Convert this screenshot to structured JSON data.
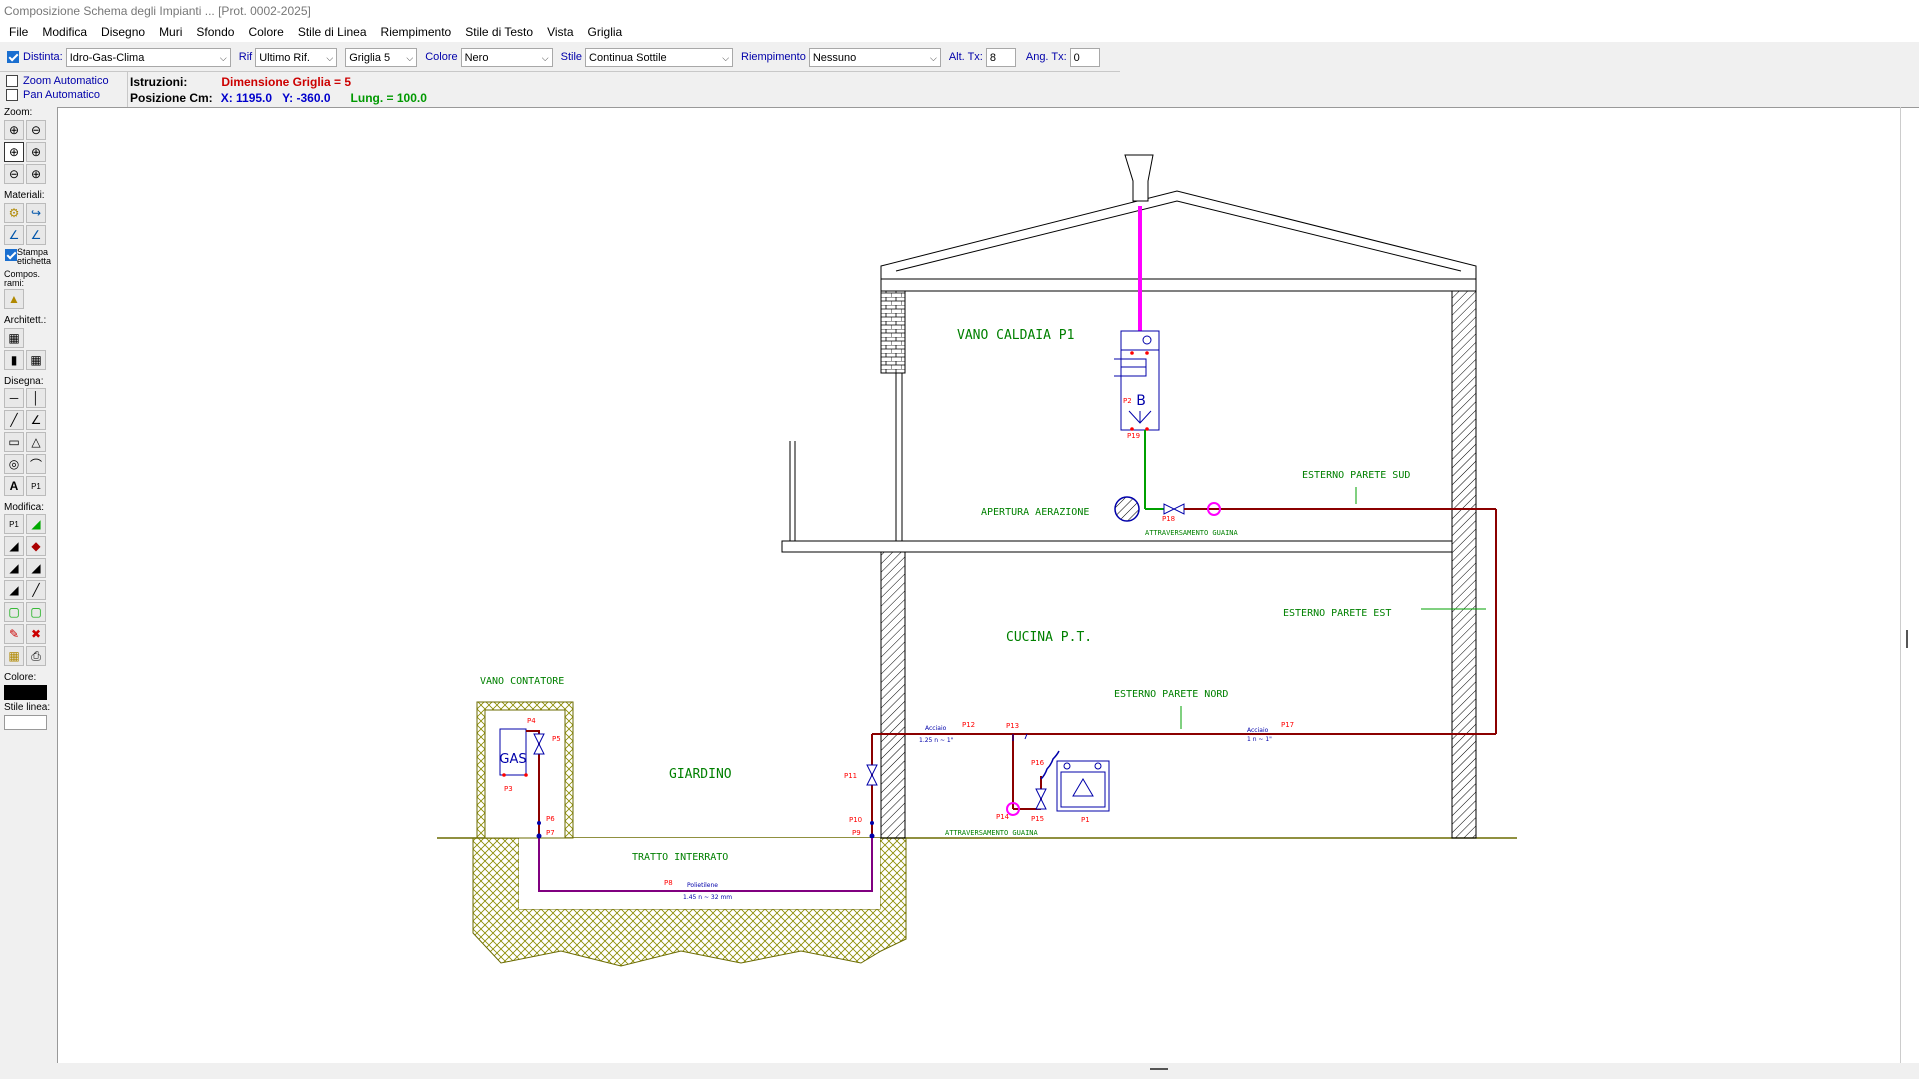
{
  "window": {
    "title": "Composizione Schema degli Impianti ...   [Prot.  0002-2025]"
  },
  "menu": [
    "File",
    "Modifica",
    "Disegno",
    "Muri",
    "Sfondo",
    "Colore",
    "Stile di Linea",
    "Riempimento",
    "Stile di Testo",
    "Vista",
    "Griglia"
  ],
  "toolbar": {
    "distinta_label": "Distinta:",
    "distinta_value": "Idro-Gas-Clima",
    "rif_label": "Rif",
    "rif_value": "Ultimo Rif.",
    "griglia_value": "Griglia  5",
    "colore_label": "Colore",
    "colore_value": "Nero",
    "stile_label": "Stile",
    "stile_value": "Continua Sottile",
    "riempimento_label": "Riempimento",
    "riempimento_value": "Nessuno",
    "alt_label": "Alt. Tx:",
    "alt_value": "8",
    "ang_label": "Ang. Tx:",
    "ang_value": "0"
  },
  "options": {
    "zoom_auto": "Zoom Automatico",
    "pan_auto": "Pan Automatico"
  },
  "instructions": {
    "istruzioni_label": "Istruzioni:",
    "istruzioni_value": "Dimensione Griglia = 5",
    "posizione_label": "Posizione  Cm:",
    "x_value": "X: 1195.0",
    "y_value": "Y:  -360.0",
    "lung_value": "Lung. =  100.0"
  },
  "sidebar": {
    "zoom": "Zoom:",
    "materiali": "Materiali:",
    "stampa": "Stampa",
    "etichetta": "etichetta",
    "compos": "Compos.",
    "rami": "rami:",
    "architett": "Architett.:",
    "disegna": "Disegna:",
    "modifica": "Modifica:",
    "colore": "Colore:",
    "stile_linea": "Stile linea:"
  },
  "drawing": {
    "labels": {
      "vano_caldaia": "VANO CALDAIA P1",
      "apertura": "APERTURA AERAZIONE",
      "esterno_sud": "ESTERNO PARETE SUD",
      "esterno_est": "ESTERNO PARETE EST",
      "esterno_nord": "ESTERNO PARETE NORD",
      "cucina": "CUCINA P.T.",
      "vano_contatore": "VANO CONTATORE",
      "giardino": "GIARDINO",
      "tratto": "TRATTO INTERRATO",
      "attraversamento1": "ATTRAVERSAMENTO GUAINA",
      "attraversamento2": "ATTRAVERSAMENTO GUAINA",
      "gas": "GAS",
      "boiler": "B"
    },
    "points": {
      "P1": "P1",
      "P2": "P2",
      "P3": "P3",
      "P4": "P4",
      "P5": "P5",
      "P6": "P6",
      "P7": "P7",
      "P8": "P8",
      "P9": "P9",
      "P10": "P10",
      "P11": "P11",
      "P12": "P12",
      "P13": "P13",
      "P14": "P14",
      "P15": "P15",
      "P16": "P16",
      "P17": "P17",
      "P18": "P18",
      "P19": "P19"
    },
    "pipe_notes": {
      "n1": "Acciaio",
      "n2": "1.25 n ~ 1\"",
      "n3": "Polietilene",
      "n4": "1.45 n ~ 32 mm",
      "n5": "Acciaio",
      "n6": "1 n ~ 1\""
    },
    "colors": {
      "gas_pipe": "#8b0000",
      "flue": "#ff00ff",
      "green_pipe": "#00a000",
      "text_green": "#008000",
      "point_red": "#ff0000",
      "fill_olive": "#9a9a00"
    }
  }
}
